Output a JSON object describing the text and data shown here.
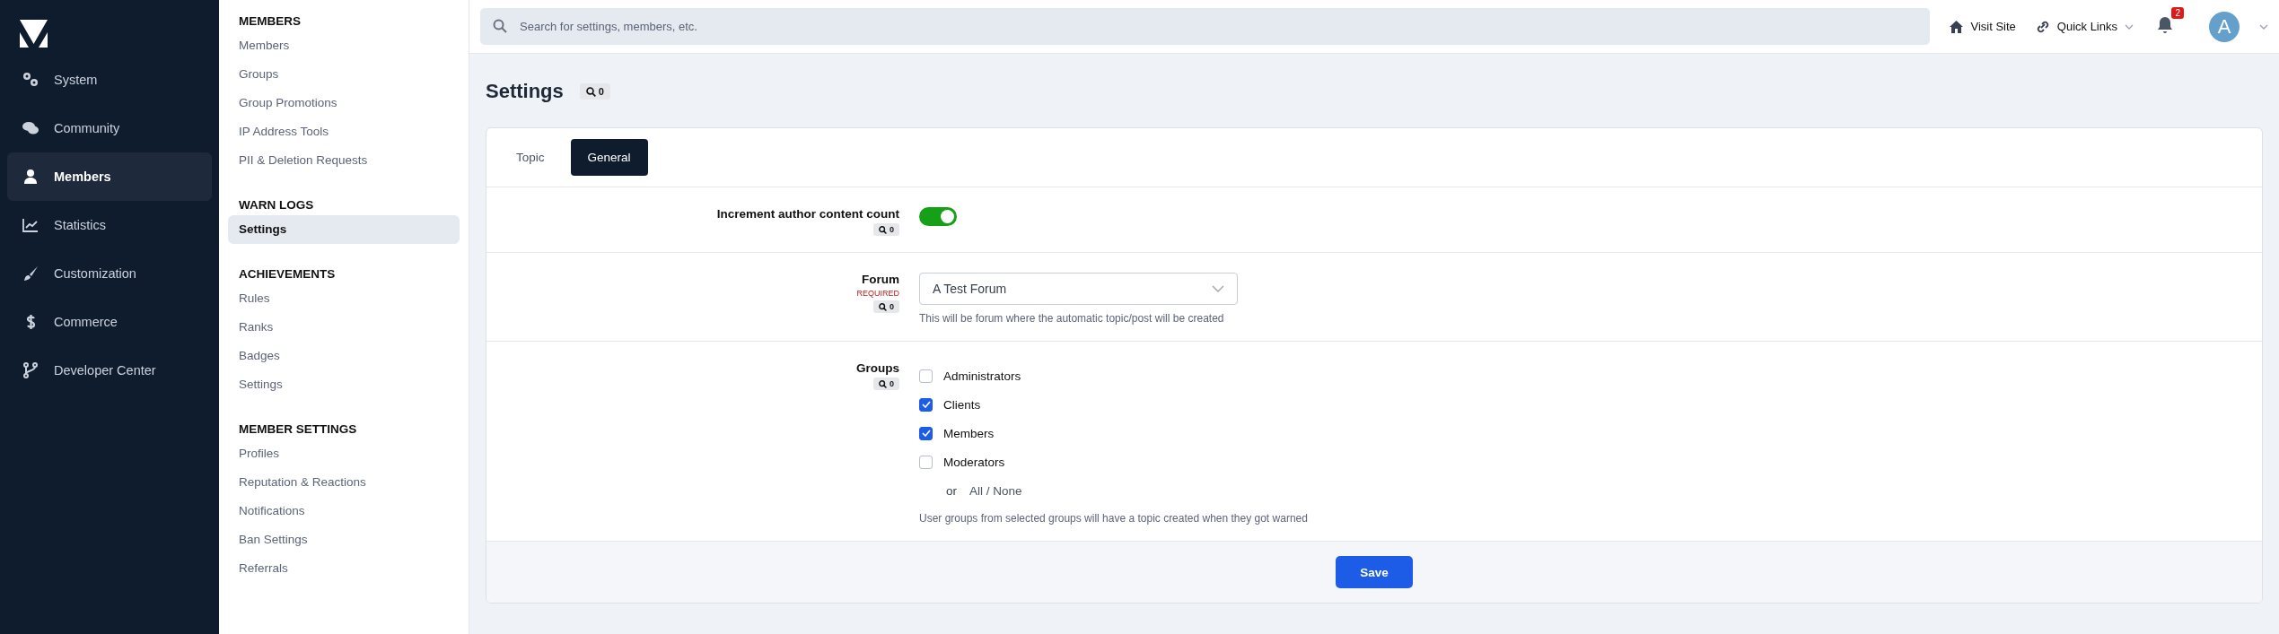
{
  "sidebar": {
    "items": [
      {
        "label": "System",
        "selected": false
      },
      {
        "label": "Community",
        "selected": false
      },
      {
        "label": "Members",
        "selected": true
      },
      {
        "label": "Statistics",
        "selected": false
      },
      {
        "label": "Customization",
        "selected": false
      },
      {
        "label": "Commerce",
        "selected": false
      },
      {
        "label": "Developer Center",
        "selected": false
      }
    ]
  },
  "subnav": {
    "sections": [
      {
        "heading": "MEMBERS",
        "items": [
          {
            "label": "Members",
            "selected": false
          },
          {
            "label": "Groups",
            "selected": false
          },
          {
            "label": "Group Promotions",
            "selected": false
          },
          {
            "label": "IP Address Tools",
            "selected": false
          },
          {
            "label": "PII & Deletion Requests",
            "selected": false
          }
        ]
      },
      {
        "heading": "WARN LOGS",
        "items": [
          {
            "label": "Settings",
            "selected": true
          }
        ]
      },
      {
        "heading": "ACHIEVEMENTS",
        "items": [
          {
            "label": "Rules",
            "selected": false
          },
          {
            "label": "Ranks",
            "selected": false
          },
          {
            "label": "Badges",
            "selected": false
          },
          {
            "label": "Settings",
            "selected": false
          }
        ]
      },
      {
        "heading": "MEMBER SETTINGS",
        "items": [
          {
            "label": "Profiles",
            "selected": false
          },
          {
            "label": "Reputation & Reactions",
            "selected": false
          },
          {
            "label": "Notifications",
            "selected": false
          },
          {
            "label": "Ban Settings",
            "selected": false
          },
          {
            "label": "Referrals",
            "selected": false
          }
        ]
      }
    ]
  },
  "topbar": {
    "search": {
      "placeholder": "Search for settings, members, etc."
    },
    "visit_site": "Visit Site",
    "quick_links": "Quick Links",
    "notifications_count": "2",
    "avatar_letter": "A"
  },
  "page": {
    "title": "Settings",
    "search_count": "0"
  },
  "tabs": [
    {
      "label": "Topic",
      "selected": false
    },
    {
      "label": "General",
      "selected": true
    }
  ],
  "fields": [
    {
      "kind": "toggle",
      "label": "Increment author content count",
      "search_count": "0",
      "on": true
    },
    {
      "kind": "select",
      "label": "Forum",
      "required": "REQUIRED",
      "search_count": "0",
      "value": "A Test Forum",
      "description": "This will be forum where the automatic topic/post will be created"
    },
    {
      "kind": "checkboxes",
      "label": "Groups",
      "search_count": "0",
      "options": [
        {
          "label": "Administrators",
          "checked": false
        },
        {
          "label": "Clients",
          "checked": true
        },
        {
          "label": "Members",
          "checked": true
        },
        {
          "label": "Moderators",
          "checked": false
        }
      ],
      "or_text": "or",
      "all_none": "All / None",
      "description": "User groups from selected groups will have a topic created when they got warned"
    }
  ],
  "save_button": "Save"
}
